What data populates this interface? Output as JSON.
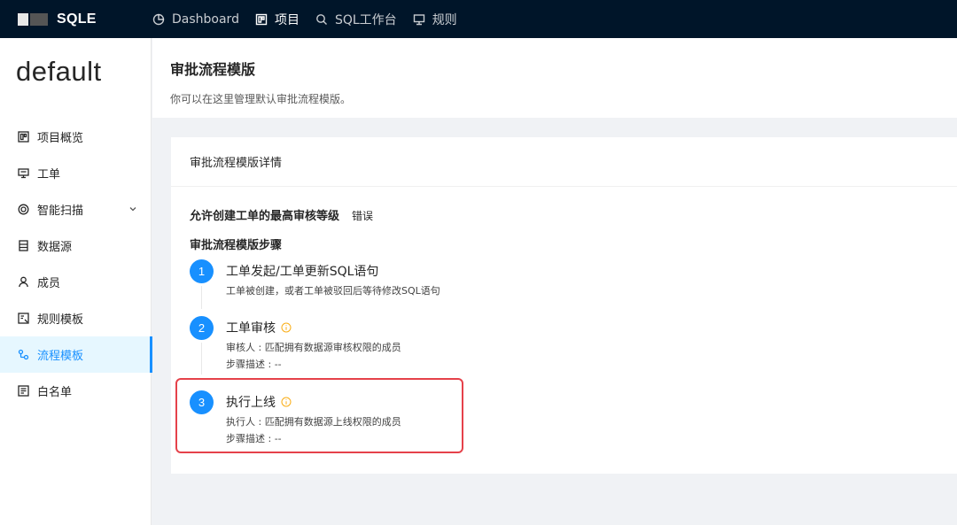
{
  "brand": {
    "name": "SQLE"
  },
  "nav": [
    {
      "label": "Dashboard",
      "icon": "dashboard-icon"
    },
    {
      "label": "项目",
      "icon": "project-icon"
    },
    {
      "label": "SQL工作台",
      "icon": "search-icon"
    },
    {
      "label": "规则",
      "icon": "monitor-icon"
    }
  ],
  "sidebar": {
    "project": "default",
    "items": [
      {
        "label": "项目概览",
        "icon": "overview-icon"
      },
      {
        "label": "工单",
        "icon": "order-icon"
      },
      {
        "label": "智能扫描",
        "icon": "scan-icon"
      },
      {
        "label": "数据源",
        "icon": "datasource-icon"
      },
      {
        "label": "成员",
        "icon": "user-icon"
      },
      {
        "label": "规则模板",
        "icon": "rule-template-icon"
      },
      {
        "label": "流程模板",
        "icon": "workflow-icon"
      },
      {
        "label": "白名单",
        "icon": "whitelist-icon"
      }
    ],
    "active": "流程模板"
  },
  "page": {
    "title": "审批流程模版",
    "description": "你可以在这里管理默认审批流程模版。"
  },
  "card": {
    "title": "审批流程模版详情",
    "level_label": "允许创建工单的最高审核等级",
    "level_value": "错误",
    "steps_title": "审批流程模版步骤",
    "steps": [
      {
        "num": "1",
        "title": "工单发起/工单更新SQL语句",
        "lines": [
          "工单被创建，或者工单被驳回后等待修改SQL语句"
        ]
      },
      {
        "num": "2",
        "title": "工单审核",
        "lines": [
          "审核人 : 匹配拥有数据源审核权限的成员",
          "步骤描述 : --"
        ]
      },
      {
        "num": "3",
        "title": "执行上线",
        "lines": [
          "执行人 : 匹配拥有数据源上线权限的成员",
          "步骤描述 : --"
        ]
      }
    ]
  },
  "colors": {
    "primary": "#1890ff",
    "topbar": "#001529",
    "highlight": "#e5414a",
    "info": "#faad14"
  }
}
